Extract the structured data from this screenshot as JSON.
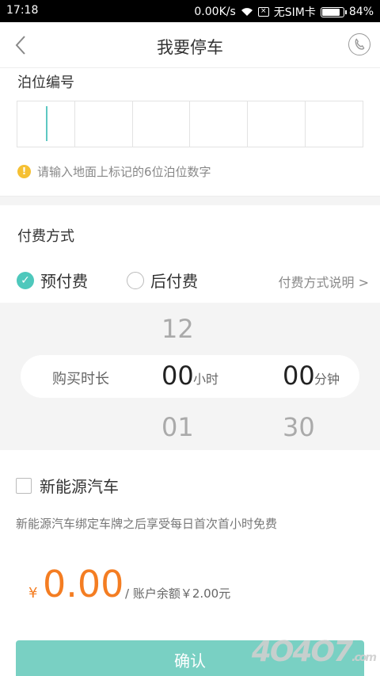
{
  "status_bar": {
    "time": "17:18",
    "speed": "0.00K/s",
    "sim": "无SIM卡",
    "battery": "84%",
    "battery_level": 0.84
  },
  "nav": {
    "title": "我要停车",
    "back_icon": "chevron-left-icon",
    "phone_icon": "phone-icon"
  },
  "berth": {
    "label": "泊位编号",
    "digits": [
      "",
      "",
      "",
      "",
      "",
      ""
    ],
    "hint": "请输入地面上标记的6位泊位数字",
    "hint_icon": "warning-icon"
  },
  "payment": {
    "label": "付费方式",
    "options": [
      {
        "label": "预付费",
        "selected": true
      },
      {
        "label": "后付费",
        "selected": false
      }
    ],
    "explain_link": "付费方式说明 >"
  },
  "duration": {
    "label": "购买时长",
    "hours_above": "12",
    "hours_selected": "00",
    "hours_below": "01",
    "hours_unit": "小时",
    "minutes_selected": "00",
    "minutes_below": "30",
    "minutes_unit": "分钟"
  },
  "new_energy": {
    "label": "新能源汽车",
    "checked": false,
    "description": "新能源汽车绑定车牌之后享受每日首次首小时免费"
  },
  "price": {
    "currency": "¥",
    "amount": "0.00",
    "balance_text": "/ 账户余额￥2.00元"
  },
  "confirm": {
    "label": "确认"
  },
  "watermark": {
    "text": "4O4O7",
    "suffix": ".com"
  },
  "colors": {
    "accent": "#4ec8bc",
    "price": "#f47d22",
    "button": "#79d0c3"
  }
}
